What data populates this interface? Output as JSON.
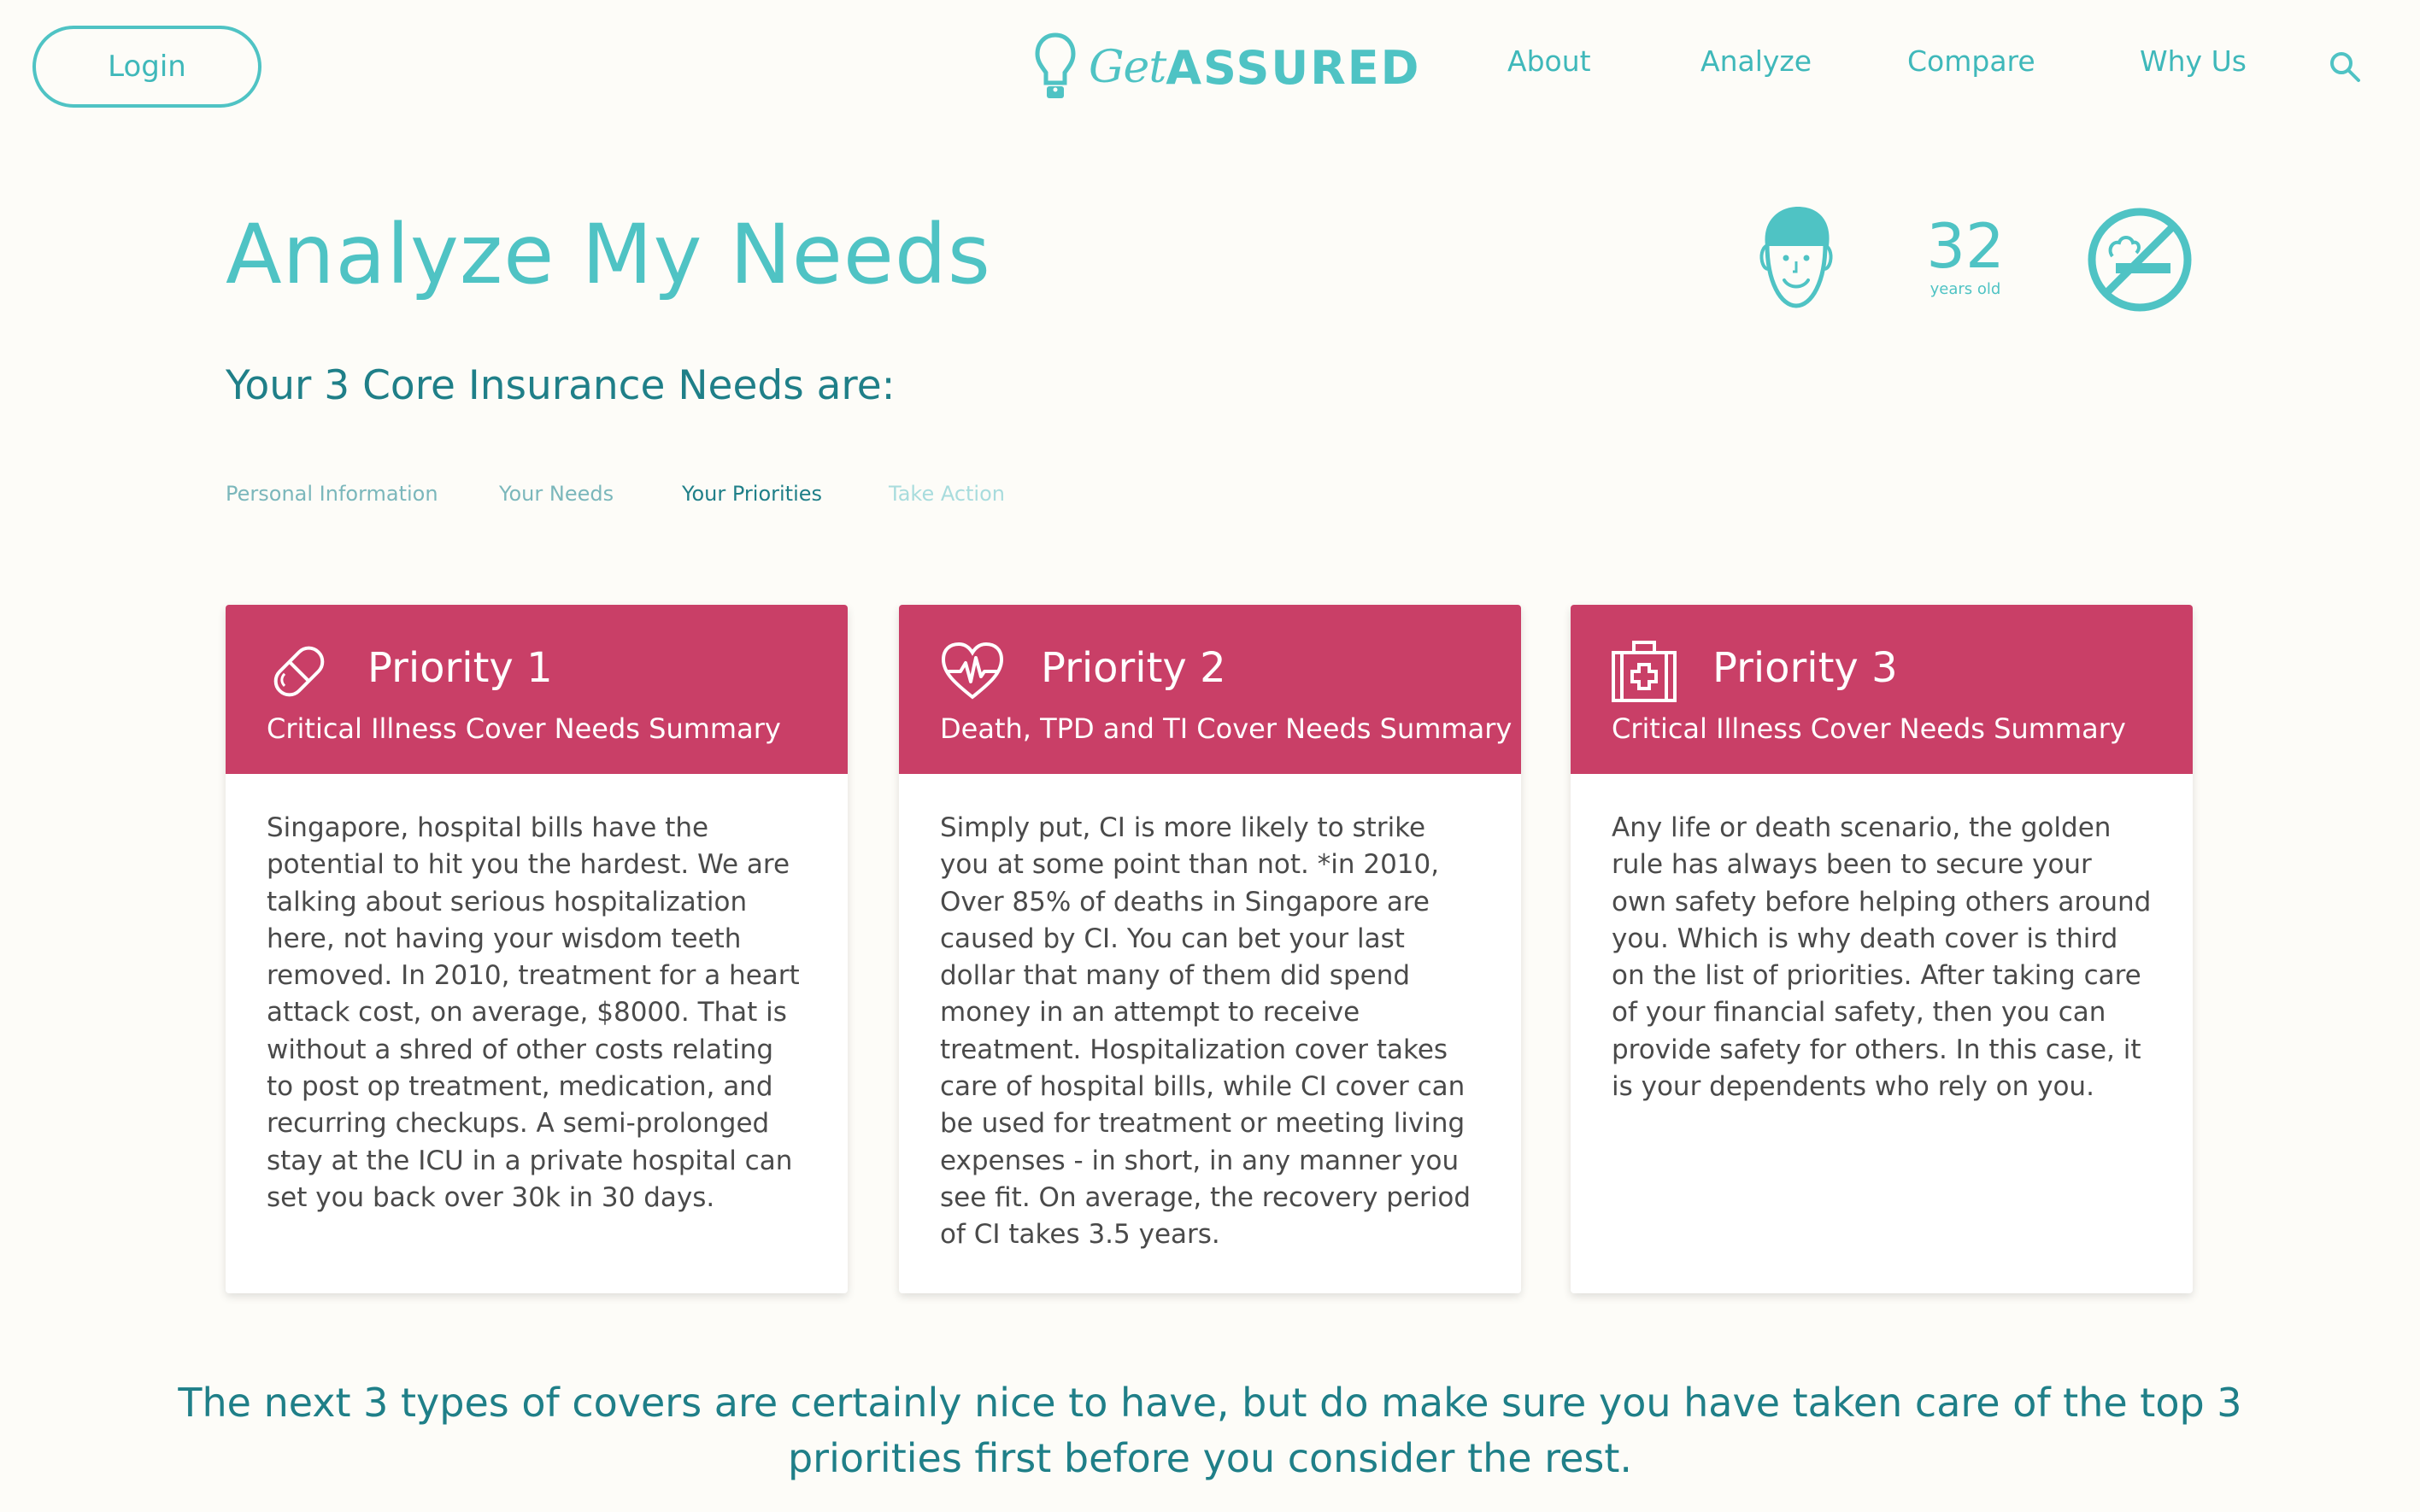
{
  "header": {
    "login_label": "Login",
    "logo_get": "Get",
    "logo_assured": "ASSURED",
    "nav": [
      "About",
      "Analyze",
      "Compare",
      "Why Us"
    ]
  },
  "profile": {
    "age": "32",
    "age_label": "years old"
  },
  "page": {
    "title": "Analyze My Needs",
    "subtitle": "Your 3 Core Insurance Needs are:"
  },
  "steps": [
    {
      "label": "Personal Information",
      "color": "#7bb7bb"
    },
    {
      "label": "Your Needs",
      "color": "#7bb7bb"
    },
    {
      "label": "Your Priorities",
      "color": "#1f7f88"
    },
    {
      "label": "Take Action",
      "color": "#a8dcdd"
    }
  ],
  "cards": [
    {
      "title": "Priority 1",
      "subtitle": "Critical Illness Cover Needs Summary",
      "icon": "pill-icon",
      "body": "Singapore, hospital bills have the potential to hit you the hardest. We are talking about serious hospitalization here, not having your wisdom teeth removed. In 2010, treatment for a heart attack cost, on average, $8000. That is without a shred of other costs relating to post op treatment, medication, and recurring checkups. A semi-prolonged stay at the ICU in a private hospital can set you back over 30k in 30 days."
    },
    {
      "title": "Priority 2",
      "subtitle": "Death, TPD and TI Cover Needs Summary",
      "icon": "heartbeat-icon",
      "body": "Simply put, CI is more likely to strike you at some point than not. *in 2010, Over 85% of deaths in Singapore are caused by CI. You can bet your last dollar that many of them did spend money in an attempt to receive treatment. Hospitalization cover takes care of hospital bills, while CI cover can be used for treatment or meeting living expenses - in short, in any manner you see fit. On average, the recovery period of CI takes 3.5 years."
    },
    {
      "title": "Priority 3",
      "subtitle": "Critical Illness Cover Needs Summary",
      "icon": "first-aid-kit-icon",
      "body": "Any life or death scenario, the golden rule has always been to secure your own safety before helping others around you. Which is why death cover is third on the list of priorities. After taking care of your financial safety, then you can provide safety for others. In this case, it is your dependents who rely on you."
    }
  ],
  "bottom_note": "The next 3 types of covers are certainly nice to have, but do make sure you have taken care of the top 3 priorities first before you consider the rest.",
  "colors": {
    "teal": "#4fc3c4",
    "dark_teal": "#1f7f88",
    "card_header": "#c93f67",
    "background": "#fdfcf8"
  }
}
